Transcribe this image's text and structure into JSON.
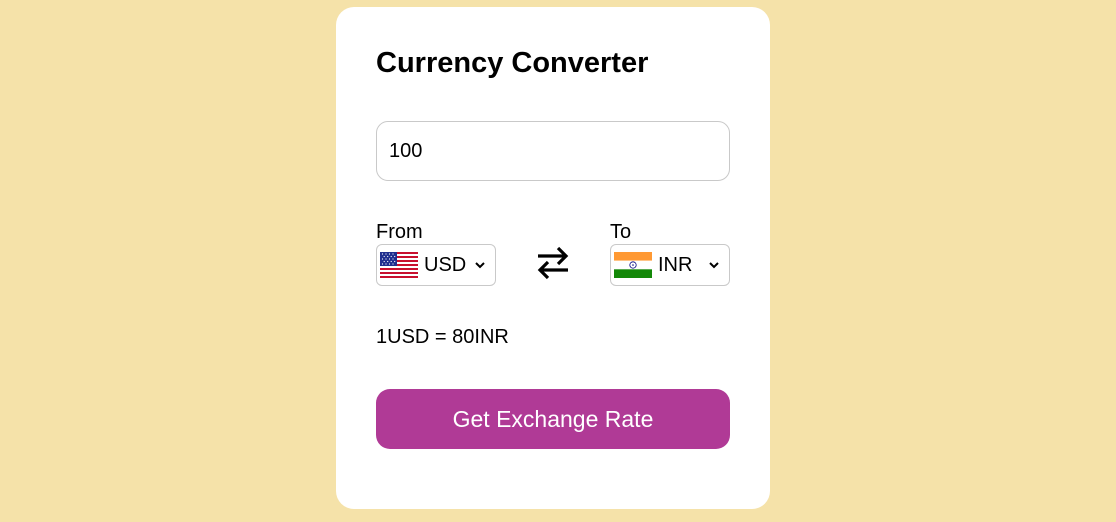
{
  "converter": {
    "title": "Currency Converter",
    "amount_value": "100",
    "from_label": "From",
    "to_label": "To",
    "from_currency": "USD",
    "to_currency": "INR",
    "from_flag_icon": "us-flag-icon",
    "to_flag_icon": "india-flag-icon",
    "swap_icon": "swap-arrows-icon",
    "exchange_rate_text": "1USD = 80INR",
    "button_label": "Get Exchange Rate"
  },
  "colors": {
    "background": "#f5e2a9",
    "card": "#ffffff",
    "button": "#b03a96",
    "button_text": "#ffffff"
  }
}
